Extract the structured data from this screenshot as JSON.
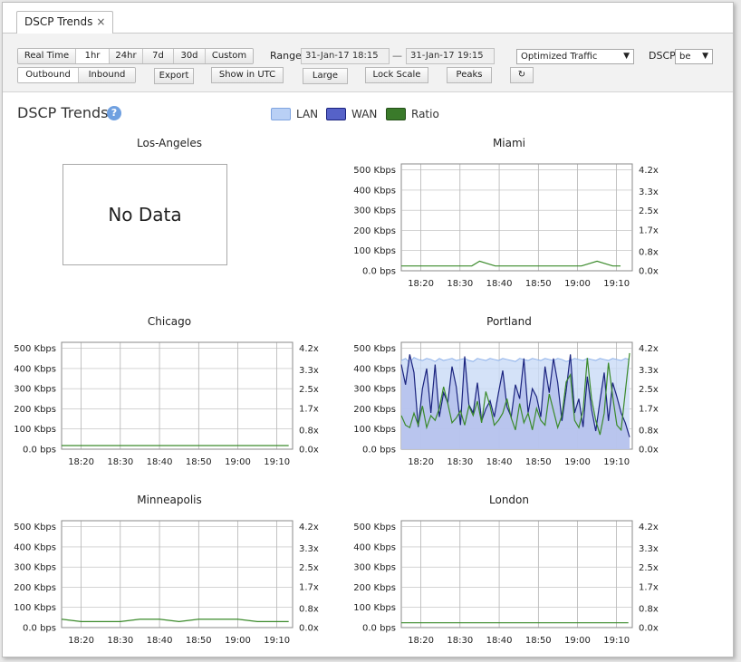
{
  "tab": {
    "label": "DSCP Trends",
    "close": "×"
  },
  "toolbar": {
    "time_buttons": [
      "Real Time",
      "1hr",
      "24hr",
      "7d",
      "30d",
      "Custom"
    ],
    "active_time": "1hr",
    "range_label": "Range",
    "range_start": "31-Jan-17 18:15",
    "range_sep": "—",
    "range_end": "31-Jan-17 19:15",
    "direction_buttons": [
      "Outbound",
      "Inbound"
    ],
    "export": "Export",
    "utc": "Show in UTC",
    "large": "Large",
    "lock_scale": "Lock Scale",
    "peaks": "Peaks",
    "refresh_icon": "↻",
    "traffic_select": "Optimized Traffic",
    "dscp_label": "DSCP",
    "dscp_select": "be"
  },
  "header": {
    "title": "DSCP Trends",
    "help": "?"
  },
  "legend": [
    {
      "label": "LAN",
      "color": "#b9d0f5"
    },
    {
      "label": "WAN",
      "color": "#5662c8"
    },
    {
      "label": "Ratio",
      "color": "#3a7a2a"
    }
  ],
  "axes": {
    "y_left": [
      "500 Kbps",
      "400 Kbps",
      "300 Kbps",
      "200 Kbps",
      "100 Kbps",
      "0.0 bps"
    ],
    "y_right": [
      "4.2x",
      "3.3x",
      "2.5x",
      "1.7x",
      "0.8x",
      "0.0x"
    ],
    "x": [
      "18:20",
      "18:30",
      "18:40",
      "18:50",
      "19:00",
      "19:10"
    ]
  },
  "colors": {
    "lan_fill": "#c9dbf6",
    "lan_line": "#8fb2ea",
    "wan_fill": "#b6c2ec",
    "wan_line": "#1a237e",
    "ratio": "#3a8a2a",
    "grid": "#999999"
  },
  "charts": [
    {
      "name": "Los-Angeles",
      "nodata": "No Data"
    },
    {
      "name": "Miami",
      "chart_data": {
        "type": "line",
        "x": [
          "18:15",
          "18:17",
          "18:19",
          "18:21",
          "18:23",
          "18:25",
          "18:27",
          "18:29",
          "18:31",
          "18:33",
          "18:35",
          "18:37",
          "18:39",
          "18:41",
          "18:43",
          "18:45",
          "18:47",
          "18:49",
          "18:51",
          "18:53",
          "18:55",
          "18:57",
          "18:59",
          "19:01",
          "19:03",
          "19:05",
          "19:07",
          "19:09",
          "19:11"
        ],
        "series": [
          {
            "name": "Ratio",
            "values": [
              0.2,
              0.2,
              0.2,
              0.2,
              0.2,
              0.2,
              0.2,
              0.2,
              0.2,
              0.2,
              0.4,
              0.3,
              0.2,
              0.2,
              0.2,
              0.2,
              0.2,
              0.2,
              0.2,
              0.2,
              0.2,
              0.2,
              0.2,
              0.2,
              0.3,
              0.4,
              0.3,
              0.2,
              0.2
            ]
          }
        ]
      }
    },
    {
      "name": "Chicago",
      "chart_data": {
        "type": "line",
        "x": [
          "18:15",
          "18:20",
          "18:25",
          "18:30",
          "18:35",
          "18:40",
          "18:45",
          "18:50",
          "18:55",
          "19:00",
          "19:05",
          "19:10",
          "19:13"
        ],
        "series": [
          {
            "name": "Ratio",
            "values": [
              0.15,
              0.15,
              0.15,
              0.15,
              0.15,
              0.15,
              0.15,
              0.15,
              0.15,
              0.15,
              0.15,
              0.15,
              0.15
            ]
          }
        ]
      }
    },
    {
      "name": "Portland",
      "chart_data": {
        "type": "area",
        "x_start": "18:15",
        "x_step_min": 1,
        "series": [
          {
            "name": "LAN",
            "values": [
              440,
              450,
              430,
              455,
              445,
              440,
              450,
              445,
              435,
              450,
              440,
              445,
              450,
              440,
              445,
              450,
              440,
              435,
              450,
              445,
              440,
              450,
              445,
              440,
              450,
              445,
              440,
              435,
              450,
              445,
              440,
              450,
              445,
              440,
              450,
              445,
              440,
              450,
              445,
              435,
              440,
              450,
              445,
              440,
              450,
              445,
              440,
              450,
              445,
              440,
              450,
              445,
              440,
              450,
              445
            ]
          },
          {
            "name": "WAN",
            "values": [
              420,
              320,
              470,
              380,
              110,
              300,
              400,
              180,
              420,
              160,
              280,
              230,
              410,
              310,
              120,
              460,
              220,
              180,
              330,
              140,
              200,
              240,
              160,
              280,
              390,
              210,
              160,
              320,
              250,
              450,
              180,
              300,
              260,
              160,
              410,
              280,
              450,
              330,
              140,
              290,
              470,
              180,
              250,
              110,
              360,
              200,
              90,
              240,
              380,
              140,
              330,
              260,
              180,
              130,
              60
            ]
          },
          {
            "name": "Ratio",
            "values": [
              1.4,
              1.0,
              0.9,
              1.5,
              1.0,
              1.8,
              0.9,
              1.4,
              1.2,
              1.7,
              2.6,
              1.9,
              1.1,
              1.3,
              1.6,
              1.0,
              1.8,
              1.4,
              2.0,
              1.1,
              2.4,
              1.8,
              1.0,
              1.2,
              1.5,
              2.1,
              1.3,
              0.8,
              1.9,
              1.1,
              1.5,
              0.8,
              1.7,
              1.2,
              1.0,
              2.3,
              1.6,
              0.9,
              1.4,
              2.8,
              3.1,
              1.2,
              0.9,
              1.6,
              3.8,
              2.1,
              1.2,
              0.6,
              1.5,
              3.6,
              2.2,
              1.0,
              0.8,
              2.4,
              4.0
            ]
          }
        ]
      }
    },
    {
      "name": "Minneapolis",
      "chart_data": {
        "type": "line",
        "x": [
          "18:15",
          "18:20",
          "18:25",
          "18:30",
          "18:35",
          "18:40",
          "18:45",
          "18:50",
          "18:55",
          "19:00",
          "19:05",
          "19:10",
          "19:13"
        ],
        "series": [
          {
            "name": "Ratio",
            "values": [
              0.35,
              0.25,
              0.25,
              0.25,
              0.35,
              0.35,
              0.25,
              0.35,
              0.35,
              0.35,
              0.25,
              0.25,
              0.25
            ]
          }
        ]
      }
    },
    {
      "name": "London",
      "chart_data": {
        "type": "line",
        "x": [
          "18:15",
          "18:20",
          "18:25",
          "18:30",
          "18:35",
          "18:40",
          "18:45",
          "18:50",
          "18:55",
          "19:00",
          "19:05",
          "19:10",
          "19:13"
        ],
        "series": [
          {
            "name": "Ratio",
            "values": [
              0.2,
              0.2,
              0.2,
              0.2,
              0.2,
              0.2,
              0.2,
              0.2,
              0.2,
              0.2,
              0.2,
              0.2,
              0.2
            ]
          }
        ]
      }
    }
  ]
}
